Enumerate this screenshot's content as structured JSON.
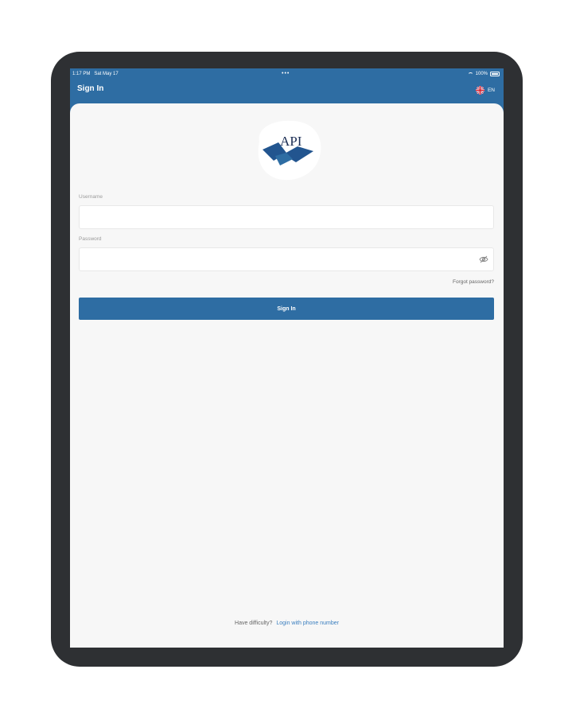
{
  "status_bar": {
    "time": "1:17 PM",
    "date": "Sat May 17",
    "dots": "•••",
    "battery": "100%"
  },
  "header": {
    "title": "Sign In",
    "language": "EN"
  },
  "logo": {
    "text": "API"
  },
  "form": {
    "username_label": "Username",
    "username_value": "",
    "password_label": "Password",
    "password_value": "",
    "forgot_password": "Forgot password?",
    "sign_in_button": "Sign In"
  },
  "footer": {
    "question": "Have difficulty?",
    "phone_link": "Login with phone number"
  },
  "colors": {
    "primary": "#2e6da3",
    "link": "#3b7fbf",
    "device_bezel": "#2e3033"
  }
}
